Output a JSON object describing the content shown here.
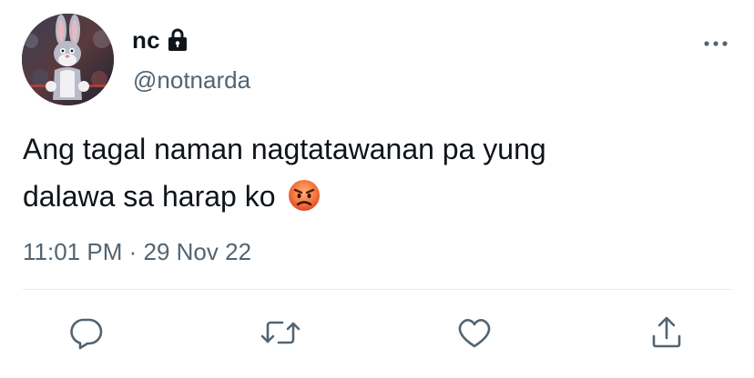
{
  "user": {
    "display_name": "nc",
    "handle": "@notnarda",
    "protected": true,
    "avatar_icon": "bugs-bunny-avatar"
  },
  "tweet": {
    "text_lines": [
      "Ang tagal naman nagtatawanan pa yung",
      "dalawa sa harap ko"
    ],
    "emoji": "😡",
    "time": "11:01 PM",
    "separator": "·",
    "date": "29 Nov 22"
  },
  "actions": [
    {
      "name": "reply",
      "icon": "reply-icon"
    },
    {
      "name": "retweet",
      "icon": "retweet-icon"
    },
    {
      "name": "like",
      "icon": "heart-icon"
    },
    {
      "name": "share",
      "icon": "share-icon"
    }
  ],
  "colors": {
    "text_primary": "#0f1419",
    "text_secondary": "#536471",
    "divider": "#e6e9eb"
  }
}
